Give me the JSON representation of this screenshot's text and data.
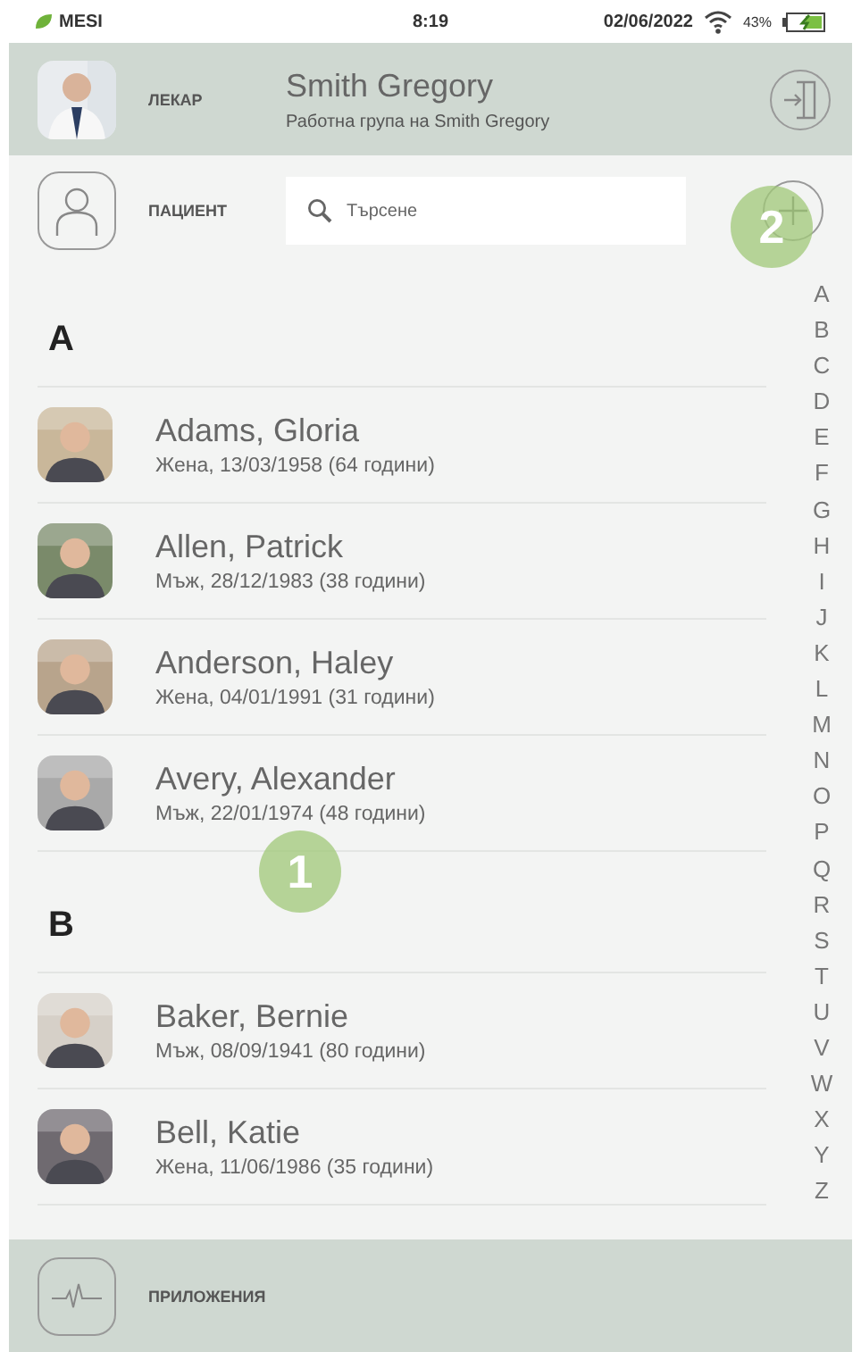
{
  "status_bar": {
    "carrier": "MESI",
    "time": "8:19",
    "date": "02/06/2022",
    "battery": "43%"
  },
  "doctor": {
    "role": "ЛЕКАР",
    "name": "Smith Gregory",
    "group": "Работна група на Smith Gregory"
  },
  "patient_bar": {
    "label": "ПАЦИЕНТ",
    "search": {
      "placeholder": "Търсене"
    }
  },
  "sections": [
    {
      "letter": "A",
      "patients": [
        {
          "name": "Adams, Gloria",
          "info": "Жена, 13/03/1958 (64 години)"
        },
        {
          "name": "Allen, Patrick",
          "info": "Мъж, 28/12/1983 (38 години)"
        },
        {
          "name": "Anderson, Haley",
          "info": "Жена, 04/01/1991 (31 години)"
        },
        {
          "name": "Avery, Alexander",
          "info": "Мъж, 22/01/1974 (48 години)"
        }
      ]
    },
    {
      "letter": "B",
      "patients": [
        {
          "name": "Baker, Bernie",
          "info": "Мъж, 08/09/1941 (80 години)"
        },
        {
          "name": "Bell, Katie",
          "info": "Жена, 11/06/1986 (35 години)"
        }
      ]
    }
  ],
  "index": [
    "A",
    "B",
    "C",
    "D",
    "E",
    "F",
    "G",
    "H",
    "I",
    "J",
    "K",
    "L",
    "M",
    "N",
    "O",
    "P",
    "Q",
    "R",
    "S",
    "T",
    "U",
    "V",
    "W",
    "X",
    "Y",
    "Z"
  ],
  "footer": {
    "label": "ПРИЛОЖЕНИЯ"
  },
  "callouts": [
    "1",
    "2"
  ]
}
